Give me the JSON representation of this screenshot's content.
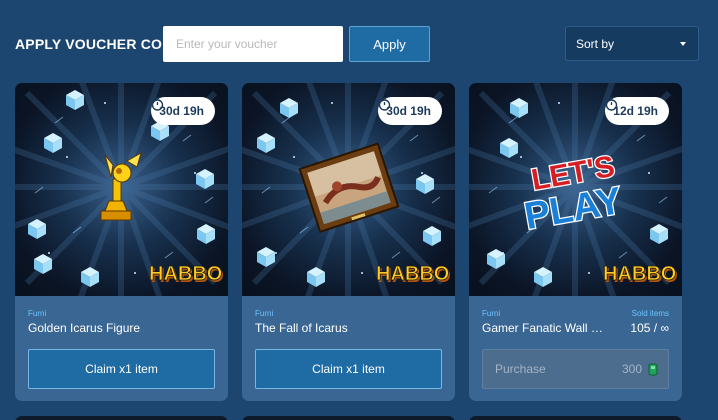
{
  "voucher": {
    "title": "APPLY VOUCHER CODE",
    "placeholder": "Enter your voucher",
    "value": "",
    "apply_label": "Apply"
  },
  "sort": {
    "label": "Sort by"
  },
  "brand": "HABBO",
  "colors": {
    "background": "#1c4670",
    "card": "#3a6693",
    "button": "#1f6ba3",
    "accent_label": "#6cc4ff"
  },
  "cards": [
    {
      "timer": "30d 19h",
      "category": "Furni",
      "name": "Golden Icarus Figure",
      "action_label": "Claim x1 item",
      "art_icon": "golden-trophy-icon"
    },
    {
      "timer": "30d 19h",
      "category": "Furni",
      "name": "The Fall of Icarus",
      "action_label": "Claim x1 item",
      "art_icon": "painting-icon"
    },
    {
      "timer": "12d 19h",
      "category": "Furni",
      "name": "Gamer Fanatic Wall …",
      "sold_label": "Sold items",
      "sold_value": "105 / ∞",
      "action_label": "Purchase",
      "price": "300",
      "art_icon": "lets-play-sign-icon",
      "art_text_top": "LET'S",
      "art_text_bottom": "PLAY"
    }
  ]
}
